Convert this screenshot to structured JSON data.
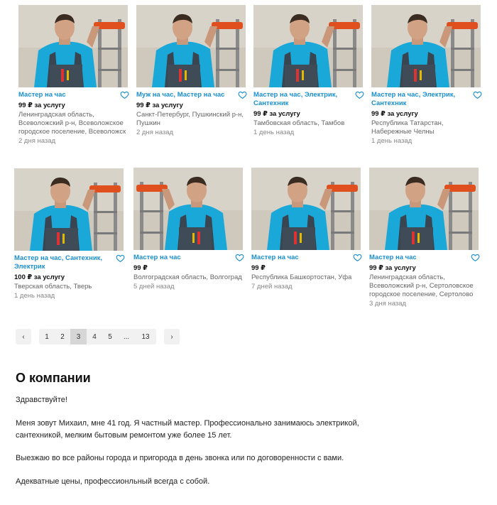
{
  "listings": [
    {
      "title": "Мастер на час",
      "price": "99 ₽ за услугу",
      "location": "Ленинградская область, Всеволожский р-н, Всеволожское городское поселение, Всеволожск",
      "date": "2 дня назад"
    },
    {
      "title": "Муж на час, Мастер на час",
      "price": "99 ₽ за услугу",
      "location": "Санкт-Петербург, Пушкинский р-н, Пушкин",
      "date": "2 дня назад"
    },
    {
      "title": "Мастер на час, Электрик, Сантехник",
      "price": "99 ₽ за услугу",
      "location": "Тамбовская область, Тамбов",
      "date": "1 день назад"
    },
    {
      "title": "Мастер на час, Электрик, Сантехник",
      "price": "99 ₽ за услугу",
      "location": "Республика Татарстан, Набережные Челны",
      "date": "1 день назад"
    },
    {
      "title": "Мастер на час, Сантехник, Электрик",
      "price": "100 ₽ за услугу",
      "location": "Тверская область, Тверь",
      "date": "1 день назад"
    },
    {
      "title": "Мастер на час",
      "price": "99 ₽",
      "location": "Волгоградская область, Волгоград",
      "date": "5 дней назад"
    },
    {
      "title": "Мастер на час",
      "price": "99 ₽",
      "location": "Республика Башкортостан, Уфа",
      "date": "7 дней назад"
    },
    {
      "title": "Мастер на час",
      "price": "99 ₽ за услугу",
      "location": "Ленинградская область, Всеволожский р-н, Сертоловское городское поселение, Сертолово",
      "date": "3 дня назад"
    }
  ],
  "pagination": {
    "prev_icon": "chevron-left-icon",
    "next_icon": "chevron-right-icon",
    "prev": "‹",
    "next": "›",
    "pages": [
      "1",
      "2",
      "3",
      "4",
      "5",
      "...",
      "13"
    ],
    "current_page": "3"
  },
  "about": {
    "heading": "О компании",
    "paragraphs": [
      "Здравствуйте!",
      "Меня зовут Михаил, мне 41 год. Я частный мастер. Профессионально занимаюсь электрикой, сантехникой, мелким бытовым ремонтом уже более 15 лет.",
      "Выезжаю во все районы города и пригорода в день звонка или по договоренности с вами.",
      "Адекватные цены, профессионльный всегда с собой."
    ]
  },
  "colors": {
    "accent": "#1a8fd1",
    "shirt": "#1aa8d8",
    "ladder": "#e0501e",
    "wall": "#cfc9bd"
  }
}
